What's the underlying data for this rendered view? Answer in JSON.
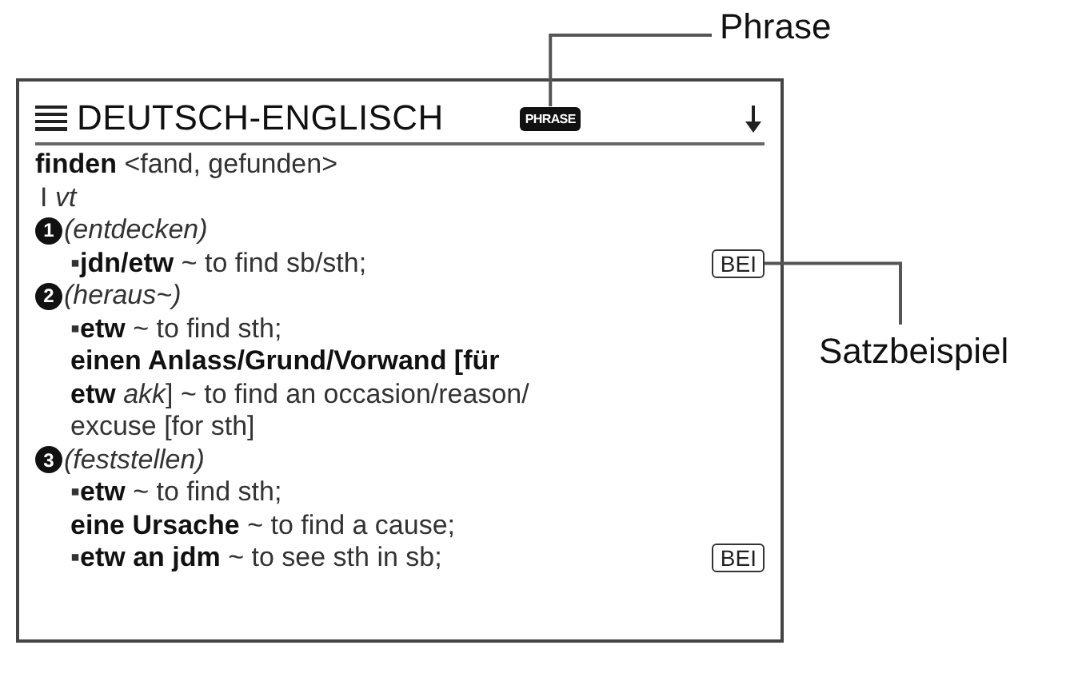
{
  "screen": {
    "title": "DEUTSCH-ENGLISCH",
    "mode_badge": "PHRASE",
    "lines": [
      {
        "kind": "headword",
        "text": "**finden** <fand, gefunden>"
      },
      {
        "kind": "pos",
        "text": "I *vt*"
      },
      {
        "kind": "sense",
        "number": "1",
        "text": "*(entdecken)*"
      },
      {
        "kind": "example",
        "text": "▪**jdn/etw** ~ to find sb/sth;",
        "badge": "BEI"
      },
      {
        "kind": "sense",
        "number": "2",
        "text": "*(heraus~)*"
      },
      {
        "kind": "example",
        "text": "▪**etw** ~ to find sth;"
      },
      {
        "kind": "example",
        "text": "**einen Anlass/Grund/Vorwand [für**"
      },
      {
        "kind": "example",
        "text": "**etw** *akk*] ~ to find an occasion/reason/"
      },
      {
        "kind": "example",
        "text": "excuse [for sth]"
      },
      {
        "kind": "sense",
        "number": "3",
        "text": "*(feststellen)*"
      },
      {
        "kind": "example",
        "text": "▪**etw** ~ to find sth;"
      },
      {
        "kind": "example",
        "text": "**eine Ursache** ~ to find a cause;"
      },
      {
        "kind": "example",
        "text": "▪**etw an jdm** ~ to see sth in sb;",
        "badge": "BEI"
      }
    ]
  },
  "callouts": [
    {
      "label": "Phrase",
      "kind": "mode"
    },
    {
      "label": "Satzbeispiel",
      "kind": "example"
    }
  ]
}
